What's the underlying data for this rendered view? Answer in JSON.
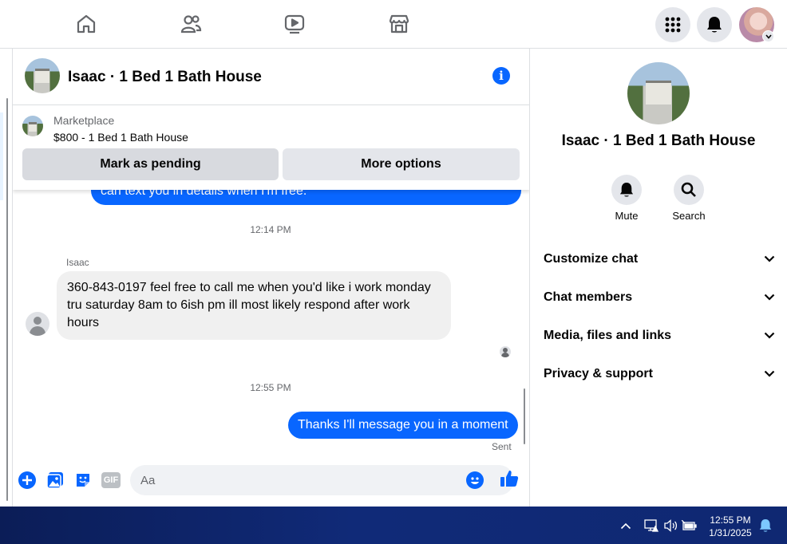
{
  "colors": {
    "accent": "#0866ff",
    "bubble_in": "#f0f0f0",
    "button_gray": "#e4e6eb",
    "taskbar": "#102a78"
  },
  "topnav": {
    "icons": [
      "home-icon",
      "friends-icon",
      "watch-icon",
      "marketplace-icon"
    ],
    "right_icons": [
      "menu-grid-icon",
      "notifications-bell-icon",
      "profile-avatar"
    ]
  },
  "chat": {
    "title": "Isaac · 1 Bed 1 Bath House",
    "listing": {
      "label": "Marketplace",
      "price_title": "$800 - 1 Bed 1 Bath House",
      "mark_pending": "Mark as pending",
      "more_options": "More options"
    },
    "messages": {
      "partial_out": "can text you in details when I'm free.",
      "time_1": "12:14 PM",
      "sender": "Isaac",
      "incoming": "360-843-0197 feel free to call me when you'd like i work monday tru saturday 8am to 6ish pm ill most likely respond after work hours",
      "time_2": "12:55 PM",
      "outgoing": "Thanks I'll message you in a moment",
      "status": "Sent"
    },
    "composer": {
      "placeholder": "Aa",
      "icons": [
        "add-icon",
        "photo-icon",
        "sticker-icon",
        "gif-icon",
        "emoji-icon",
        "thumbs-up-icon"
      ],
      "gif_label": "GIF"
    }
  },
  "details": {
    "title": "Isaac · 1 Bed 1 Bath House",
    "actions": {
      "mute": "Mute",
      "search": "Search"
    },
    "sections": [
      "Customize chat",
      "Chat members",
      "Media, files and links",
      "Privacy & support"
    ]
  },
  "taskbar": {
    "time": "12:55 PM",
    "date": "1/31/2025"
  }
}
